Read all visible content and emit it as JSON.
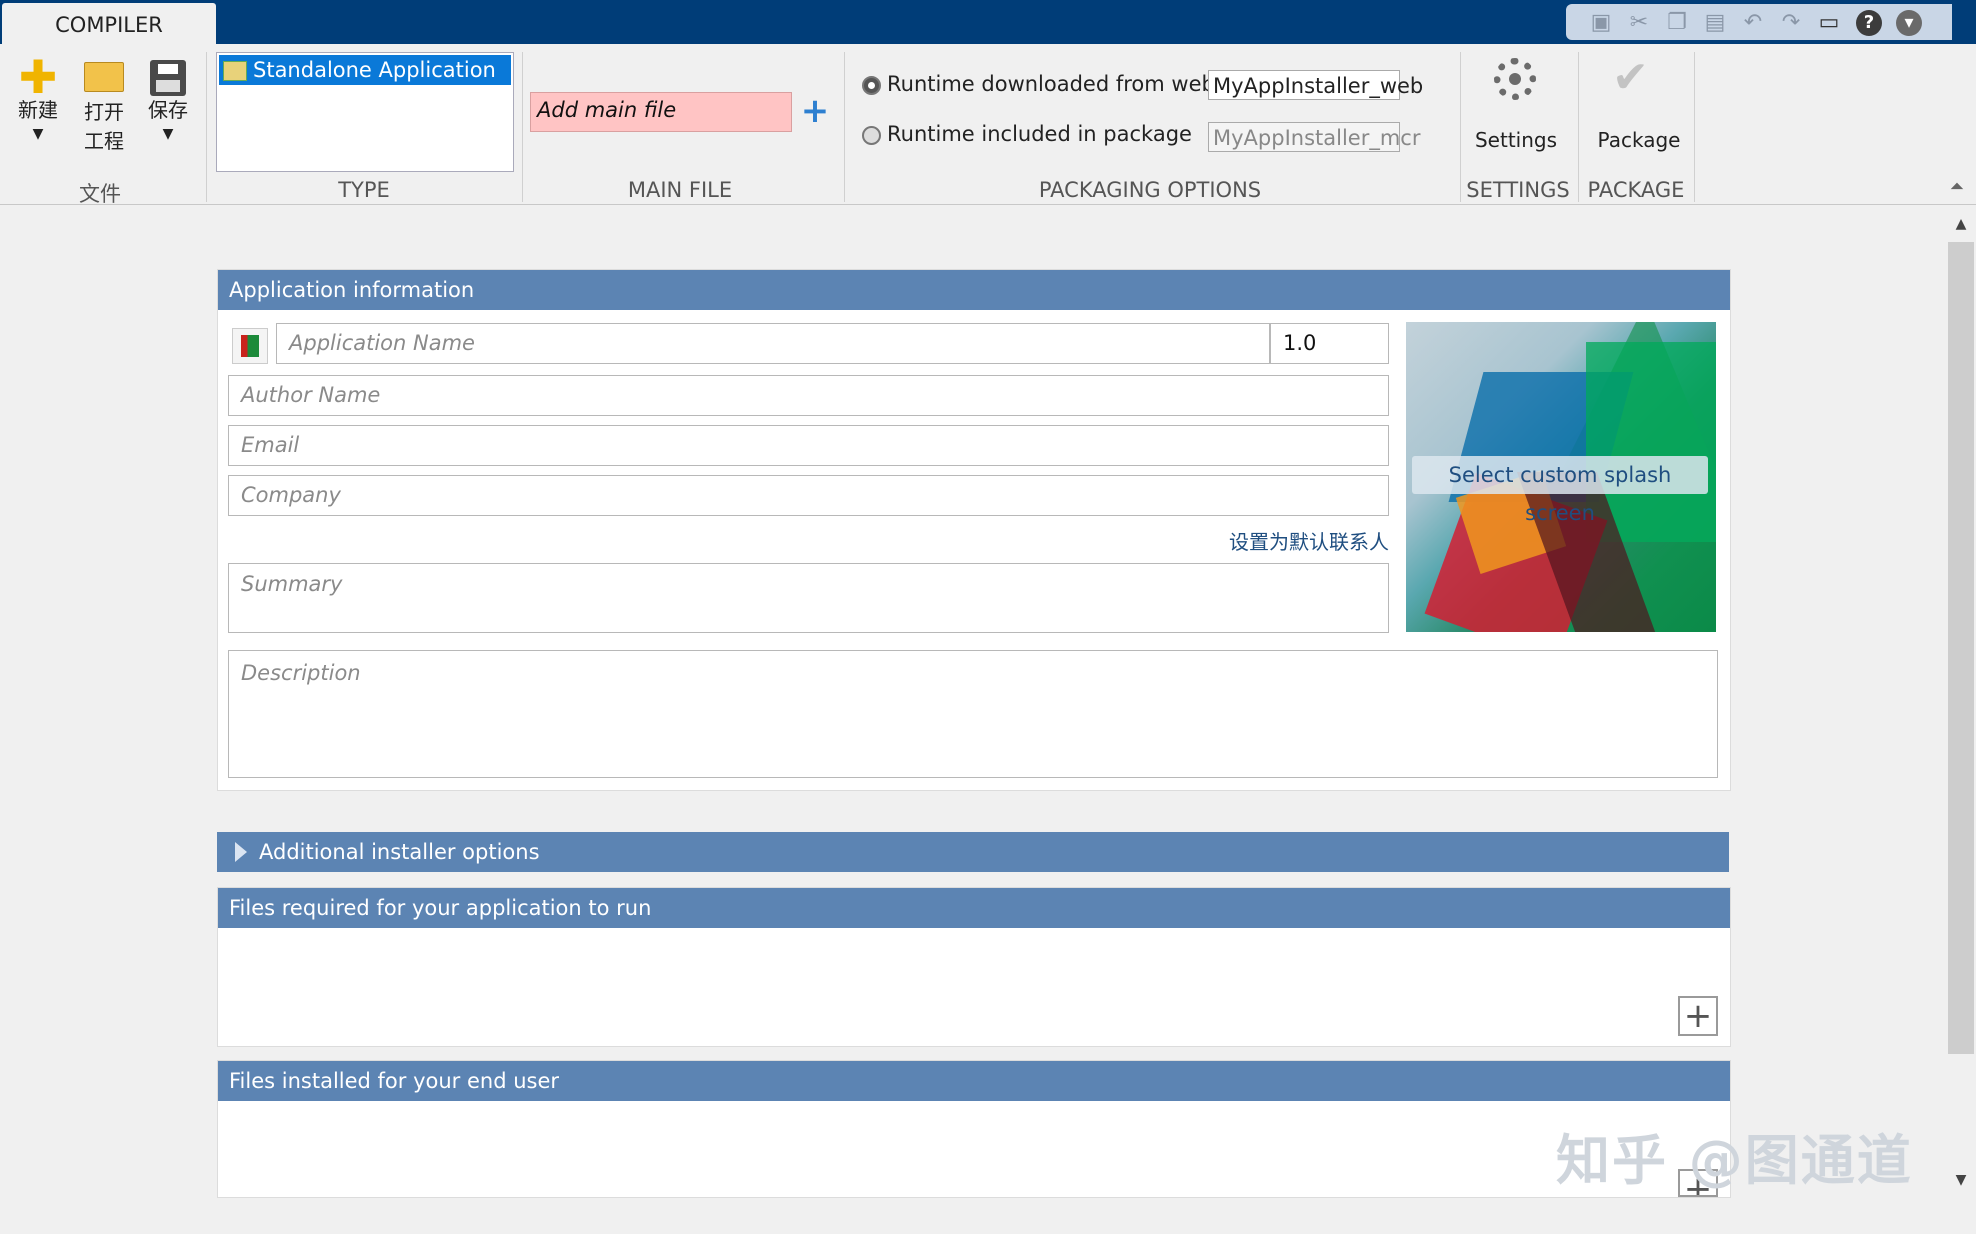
{
  "tabs": {
    "active": "COMPILER"
  },
  "toolstrip": {
    "file": {
      "section_label": "文件",
      "new_label": "新建",
      "open_label_1": "打开",
      "open_label_2": "工程",
      "save_label": "保存"
    },
    "type": {
      "section_label": "TYPE",
      "selected": "Standalone Application"
    },
    "main_file": {
      "section_label": "MAIN FILE",
      "placeholder": "Add main file"
    },
    "packaging": {
      "section_label": "PACKAGING OPTIONS",
      "web_label": "Runtime downloaded from web",
      "web_value": "MyAppInstaller_web",
      "package_label": "Runtime included in package",
      "package_value": "MyAppInstaller_mcr",
      "selected": "web"
    },
    "settings": {
      "section_label": "SETTINGS",
      "button_label": "Settings"
    },
    "package": {
      "section_label": "PACKAGE",
      "button_label": "Package"
    }
  },
  "app_info": {
    "header": "Application information",
    "app_name_placeholder": "Application Name",
    "version": "1.0",
    "author_placeholder": "Author Name",
    "email_placeholder": "Email",
    "company_placeholder": "Company",
    "set_default_contact": "设置为默认联系人",
    "summary_placeholder": "Summary",
    "description_placeholder": "Description",
    "splash_label": "Select custom splash screen"
  },
  "sections": {
    "additional_options": "Additional installer options",
    "files_required": "Files required for your application to run",
    "files_installed": "Files installed for your end user"
  },
  "watermark": "知乎 @图通道",
  "colors": {
    "title_bar": "#003d78",
    "panel_header": "#5c84b3",
    "selection": "#0a79d8",
    "main_file_bg": "#ffc4c4"
  }
}
